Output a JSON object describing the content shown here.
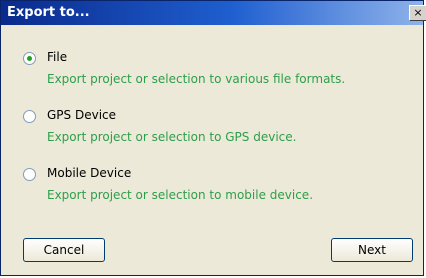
{
  "window": {
    "title": "Export to...",
    "close_glyph": "×"
  },
  "options": [
    {
      "label": "File",
      "description": "Export project or selection to various file formats.",
      "selected": true
    },
    {
      "label": "GPS Device",
      "description": "Export project or selection to GPS device.",
      "selected": false
    },
    {
      "label": "Mobile Device",
      "description": "Export project or selection to mobile device.",
      "selected": false
    }
  ],
  "buttons": {
    "cancel_label": "Cancel",
    "next_label": "Next"
  },
  "colors": {
    "titlebar_start": "#0a2a8c",
    "titlebar_end": "#8fb3ea",
    "description_text": "#2e9e4a",
    "radio_selected": "#21a121",
    "dialog_bg": "#ece9d8"
  },
  "icons": {
    "close": "close-icon",
    "radio_selected": "radio-selected-icon",
    "radio_unselected": "radio-unselected-icon"
  }
}
